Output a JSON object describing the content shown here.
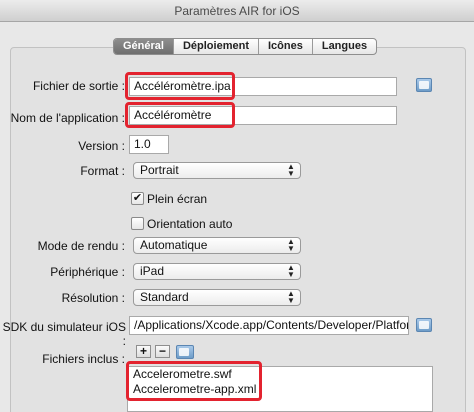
{
  "window": {
    "title": "Paramètres AIR for iOS"
  },
  "tabs": [
    {
      "label": "Général",
      "active": true
    },
    {
      "label": "Déploiement",
      "active": false
    },
    {
      "label": "Icônes",
      "active": false
    },
    {
      "label": "Langues",
      "active": false
    }
  ],
  "form": {
    "output_file": {
      "label": "Fichier de sortie",
      "value": "Accéléromètre.ipa"
    },
    "app_name": {
      "label": "Nom de l'application",
      "value": "Accéléromètre"
    },
    "version": {
      "label": "Version",
      "value": "1.0"
    },
    "format": {
      "label": "Format",
      "value": "Portrait"
    },
    "fullscreen": {
      "label": "Plein écran",
      "checked": true
    },
    "auto_orientation": {
      "label": "Orientation auto",
      "checked": false
    },
    "render_mode": {
      "label": "Mode de rendu",
      "value": "Automatique"
    },
    "device": {
      "label": "Périphérique",
      "value": "iPad"
    },
    "resolution": {
      "label": "Résolution",
      "value": "Standard"
    },
    "simulator_sdk": {
      "label": "SDK du simulateur iOS",
      "value": "/Applications/Xcode.app/Contents/Developer/Platfor"
    },
    "included_files": {
      "label": "Fichiers inclus",
      "items": [
        "Accelerometre.swf",
        "Accelerometre-app.xml"
      ]
    }
  },
  "icons": {
    "add": "plus-icon",
    "remove": "minus-icon",
    "add_folder": "folder-icon",
    "browse": "folder-icon",
    "check": "✔"
  },
  "colors": {
    "highlight": "#e3232f",
    "tab_active": "#7a7a7a"
  }
}
